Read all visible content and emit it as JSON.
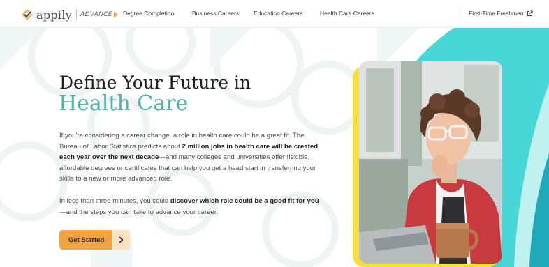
{
  "header": {
    "logo": {
      "word": "appily",
      "tagline": "ADVANCE"
    },
    "nav": [
      {
        "label": "Degree Completion"
      },
      {
        "label": "Business Careers"
      },
      {
        "label": "Education Careers"
      },
      {
        "label": "Health Care Careers"
      }
    ],
    "freshmen_link": "First-Time Freshmen"
  },
  "hero": {
    "title": "Define Your Future in",
    "title_accent": "Health Care",
    "para1": [
      {
        "text": "If you're considering a career change, a role in health care could be a great fit. The Bureau of Labor Statistics predicts about ",
        "bold": false
      },
      {
        "text": "2 million jobs in health care will be created each year over the next decade",
        "bold": true
      },
      {
        "text": "—and many colleges and universities offer flexible, affordable degrees or certificates that can help you get a head start in transferring your skills to a new or more advanced role.",
        "bold": false
      }
    ],
    "para2": [
      {
        "text": "In less than three minutes, you could ",
        "bold": false
      },
      {
        "text": "discover which role could be a good fit for you",
        "bold": true
      },
      {
        "text": "—and the steps you can take to advance your career.",
        "bold": false
      }
    ],
    "cta_label": "Get Started"
  },
  "colors": {
    "accent_teal": "#4fb3a9",
    "bright_teal": "#3fd0d4",
    "cta_orange": "#f1a340",
    "photo_frame_yellow": "#f6df3a"
  },
  "icons": {
    "logo": "appily-checkmark-logo-icon",
    "external": "external-link-icon",
    "cta": "chevron-right-icon"
  }
}
